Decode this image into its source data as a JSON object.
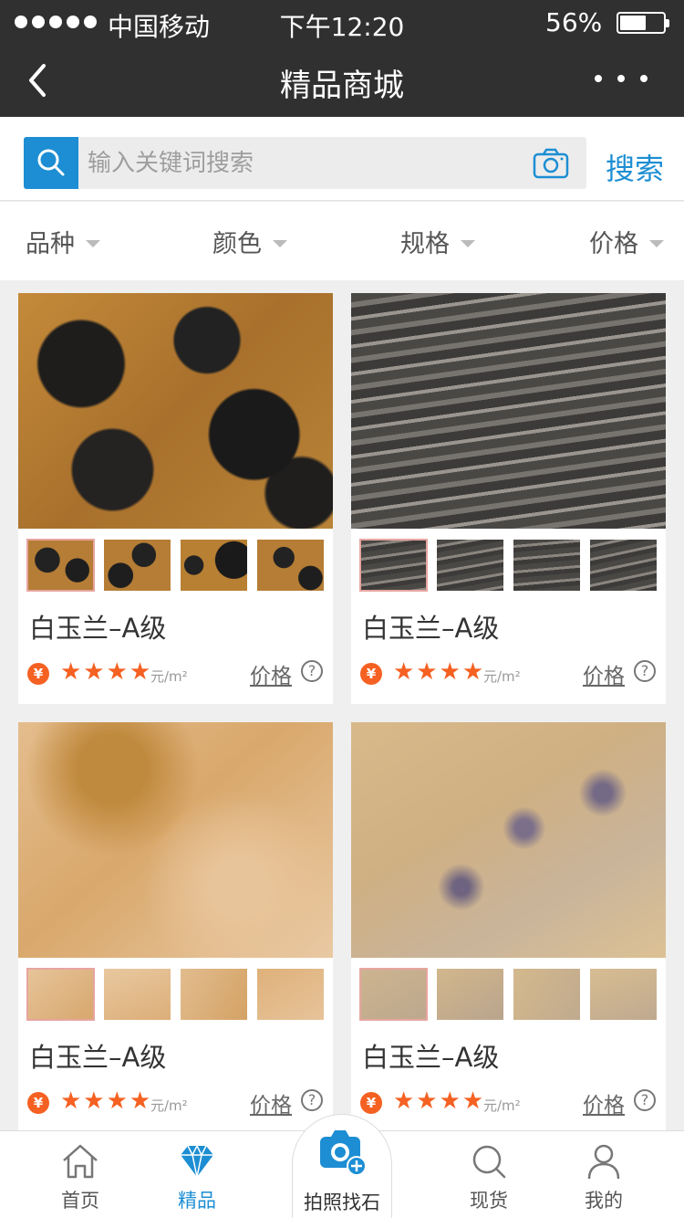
{
  "status_bar": {
    "carrier": "中国移动",
    "time": "下午12:20",
    "battery": "56%",
    "battery_level": 0.56
  },
  "nav": {
    "title": "精品商城"
  },
  "search": {
    "placeholder": "输入关键词搜索",
    "button_label": "搜索"
  },
  "filters": [
    {
      "label": "品种"
    },
    {
      "label": "颜色"
    },
    {
      "label": "规格"
    },
    {
      "label": "价格"
    }
  ],
  "products": [
    {
      "name": "白玉兰–A级",
      "currency_symbol": "¥",
      "stars": "★★★★",
      "rating": 4,
      "unit": "元/m²",
      "price_label": "价格",
      "help": "?"
    },
    {
      "name": "白玉兰–A级",
      "currency_symbol": "¥",
      "stars": "★★★★",
      "rating": 4,
      "unit": "元/m²",
      "price_label": "价格",
      "help": "?"
    },
    {
      "name": "白玉兰–A级",
      "currency_symbol": "¥",
      "stars": "★★★★",
      "rating": 4,
      "unit": "元/m²",
      "price_label": "价格",
      "help": "?"
    },
    {
      "name": "白玉兰–A级",
      "currency_symbol": "¥",
      "stars": "★★★★",
      "rating": 4,
      "unit": "元/m²",
      "price_label": "价格",
      "help": "?"
    }
  ],
  "tabbar": {
    "home": "首页",
    "featured": "精品",
    "photo_search": "拍照找石",
    "in_stock": "现货",
    "mine": "我的"
  },
  "colors": {
    "accent": "#1d8ed3",
    "price_orange": "#f56122",
    "header_bg": "#303030"
  }
}
